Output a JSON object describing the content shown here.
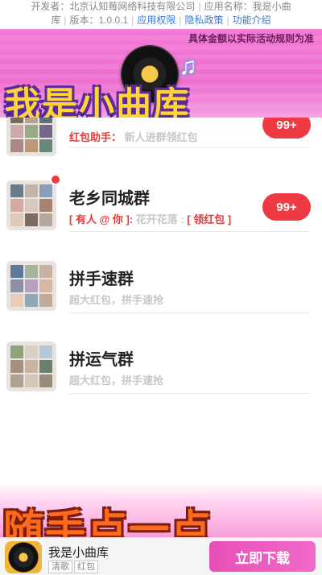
{
  "dev_info": {
    "developer_label": "开发者：北京认知莓网络科技有限公司",
    "app_name_label": "应用名称：我是小曲库",
    "version_label": "版本：1.0.0.1",
    "permissions_link": "应用权限",
    "privacy_link": "隐私政策",
    "features_link": "功能介绍"
  },
  "banner": {
    "notice": "具体金额以实际活动规则为准",
    "logo": "我是小曲库"
  },
  "groups": [
    {
      "title": "",
      "prefix": "红包助手：",
      "message": "新人进群领红包",
      "badge": "99+",
      "avatar_colors": [
        "#7a6a5a",
        "#b9a38e",
        "#5e6d7a",
        "#caa",
        "#9a8",
        "#768",
        "#a88",
        "#b97",
        "#687"
      ]
    },
    {
      "title": "老乡同城群",
      "prefix": "[ 有人 @ 你 ]:",
      "message": "花开花落 :",
      "tag": "[ 领红包 ]",
      "badge": "99+",
      "avatar_colors": [
        "#6b7b8c",
        "#c4b6a6",
        "#8aa0b8",
        "#d4a9a0",
        "#d8c8bd",
        "#a48372",
        "#e0c8b8",
        "#7d6a64",
        "#b8a89c"
      ]
    },
    {
      "title": "拼手速群",
      "message": "超大红包，拼手速抢",
      "avatar_colors": [
        "#5b7a9a",
        "#a6b39a",
        "#c9b2a2",
        "#8e8fa8",
        "#b6a0c0",
        "#d7b7a4",
        "#e8cbb8",
        "#90a7b7",
        "#c2aa98"
      ]
    },
    {
      "title": "拼运气群",
      "message": "超大红包，拼手速抢",
      "avatar_colors": [
        "#8fa37a",
        "#d8d0c0",
        "#b7c7d6",
        "#a78f7f",
        "#cbb3a3",
        "#6d7f6d",
        "#b0a090",
        "#d6c6b6",
        "#9a8a7a"
      ]
    }
  ],
  "bottom_banner": {
    "text": "随手点一点"
  },
  "download_bar": {
    "app_name": "我是小曲库",
    "tags": [
      "清歌",
      "红包"
    ],
    "button": "立即下载"
  },
  "colors": {
    "accent_pink": "#ee6ed0",
    "badge_red": "#ef3a43",
    "button_pink": "#e84fb8"
  }
}
